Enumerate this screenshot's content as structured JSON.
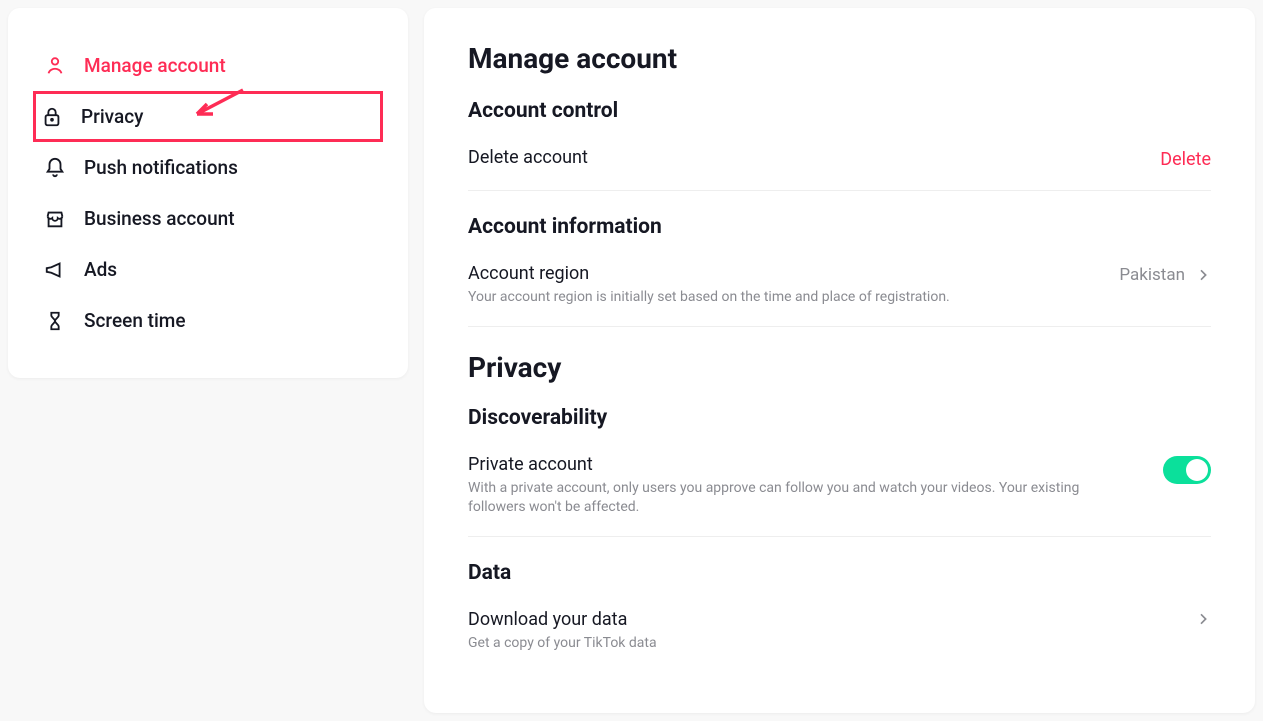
{
  "sidebar": {
    "items": [
      {
        "label": "Manage account"
      },
      {
        "label": "Privacy"
      },
      {
        "label": "Push notifications"
      },
      {
        "label": "Business account"
      },
      {
        "label": "Ads"
      },
      {
        "label": "Screen time"
      }
    ]
  },
  "main": {
    "heading": "Manage account",
    "account_control": {
      "title": "Account control",
      "delete_label": "Delete account",
      "delete_action": "Delete"
    },
    "account_info": {
      "title": "Account information",
      "region_label": "Account region",
      "region_desc": "Your account region is initially set based on the time and place of registration.",
      "region_value": "Pakistan"
    },
    "privacy": {
      "heading": "Privacy",
      "discoverability": {
        "title": "Discoverability",
        "private_label": "Private account",
        "private_desc": "With a private account, only users you approve can follow you and watch your videos. Your existing followers won't be affected."
      },
      "data": {
        "title": "Data",
        "download_label": "Download your data",
        "download_desc": "Get a copy of your TikTok data"
      }
    }
  }
}
